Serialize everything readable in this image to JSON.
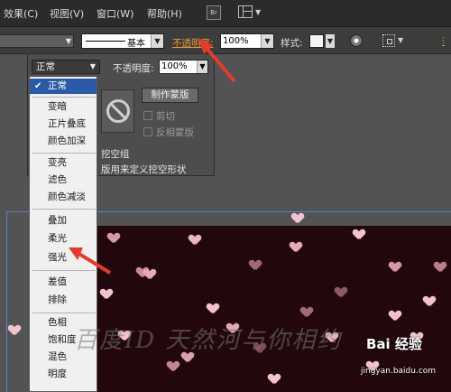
{
  "menubar": {
    "items": [
      "效果(C)",
      "视图(V)",
      "窗口(W)",
      "帮助(H)"
    ],
    "br_button": "Br"
  },
  "controlbar": {
    "stroke_label": "基本",
    "opacity_link": "不透明度:",
    "opacity_value": "100%",
    "style_label": "样式:"
  },
  "panel": {
    "blend_mode": "正常",
    "opacity_label": "不透明度:",
    "opacity_value": "100%",
    "make_mask_label": "制作蒙版",
    "clip_label": "剪切",
    "invert_mask_label": "反相蒙版",
    "knockout_label": "挖空组",
    "knockout_define_label": "版用来定义挖空形状"
  },
  "blend_menu": {
    "groups": [
      [
        "正常"
      ],
      [
        "变暗",
        "正片叠底",
        "颜色加深"
      ],
      [
        "变亮",
        "滤色",
        "颜色减淡"
      ],
      [
        "叠加",
        "柔光",
        "强光"
      ],
      [
        "差值",
        "排除"
      ],
      [
        "色相",
        "饱和度",
        "混色",
        "明度"
      ]
    ],
    "selected": "正常"
  },
  "watermark": {
    "text": "百度ID 天然河与你相约",
    "logo": "Bai 经验",
    "url": "jingyan.baidu.com"
  },
  "colors": {
    "accent_orange": "#e89a3c",
    "annotation_red": "#e53a2f",
    "selection_blue": "#2b5aa8",
    "artboard_bg": "#22080c",
    "heart_pink": "#f2c3cc"
  },
  "icons": {
    "checkmark": "check-icon",
    "no_mask": "no-mask-icon",
    "recolor": "recolor-icon",
    "align": "align-icon"
  }
}
